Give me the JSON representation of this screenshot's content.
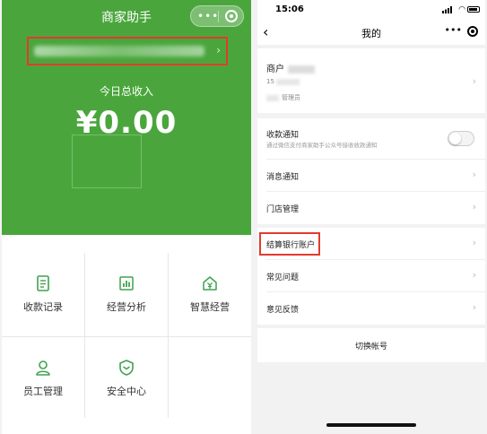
{
  "left": {
    "title": "商家助手",
    "income_label": "今日总收入",
    "income_value": "¥0.00",
    "grid": [
      {
        "label": "收款记录",
        "icon": "receipt-icon"
      },
      {
        "label": "经营分析",
        "icon": "bar-chart-icon"
      },
      {
        "label": "智慧经营",
        "icon": "smart-shop-icon"
      },
      {
        "label": "员工管理",
        "icon": "user-icon"
      },
      {
        "label": "安全中心",
        "icon": "shield-icon"
      }
    ]
  },
  "right": {
    "status_time": "15:06",
    "nav_title": "我的",
    "account": {
      "name_prefix": "商户",
      "id_prefix": "15",
      "role": "管理员"
    },
    "notify": {
      "title": "收款通知",
      "desc": "通过微信支付商家助手公众号接收收款通知"
    },
    "rows": [
      "消息通知",
      "门店管理",
      "结算银行账户",
      "常见问题",
      "意见反馈"
    ],
    "switch_label": "切换帐号"
  },
  "colors": {
    "brand_green": "#4aa63c",
    "highlight_red": "#e23b2e"
  }
}
